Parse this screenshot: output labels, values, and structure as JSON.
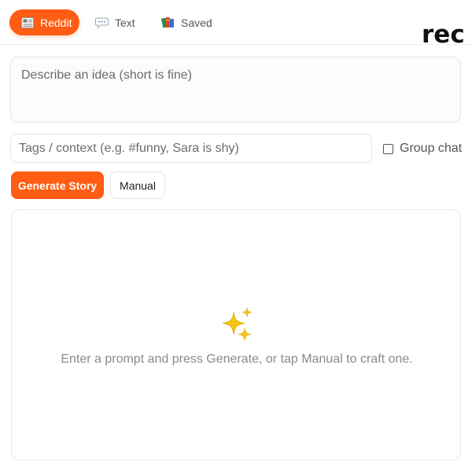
{
  "tabs": [
    {
      "label": "Reddit",
      "icon": "newspaper-icon",
      "active": true
    },
    {
      "label": "Text",
      "icon": "speech-bubble-icon",
      "active": false
    },
    {
      "label": "Saved",
      "icon": "books-icon",
      "active": false
    }
  ],
  "brand": {
    "text": "rec"
  },
  "form": {
    "idea_placeholder": "Describe an idea (short is fine)",
    "tags_placeholder": "Tags / context (e.g. #funny, Sara is shy)",
    "group_chat_label": "Group chat",
    "group_chat_checked": false
  },
  "actions": {
    "generate_label": "Generate Story",
    "manual_label": "Manual"
  },
  "story_panel": {
    "icon": "sparkles-icon",
    "empty_message": "Enter a prompt and press Generate, or tap Manual to craft one."
  },
  "colors": {
    "accent": "#ff5c14",
    "sparkle": "#f5c518"
  }
}
